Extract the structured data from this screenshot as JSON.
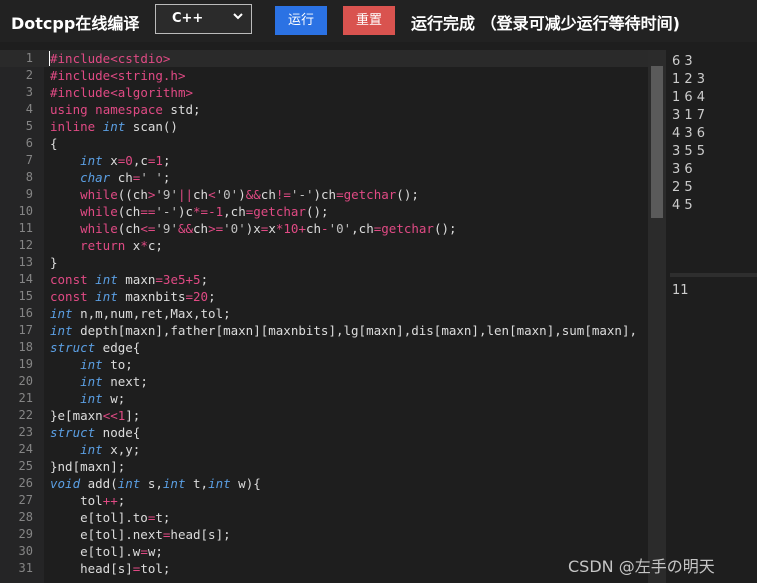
{
  "app": {
    "title": "Dotcpp在线编译"
  },
  "toolbar": {
    "language": "C++",
    "run_label": "运行",
    "reset_label": "重置",
    "status": "运行完成 （登录可减少运行等待时间)"
  },
  "editor": {
    "lines": [
      {
        "n": "1",
        "h": "<span class=\"kw\">#include</span><span class=\"kw\">&lt;cstdio&gt;</span>"
      },
      {
        "n": "2",
        "h": "<span class=\"kw\">#include</span><span class=\"kw\">&lt;string.h&gt;</span>"
      },
      {
        "n": "3",
        "h": "<span class=\"kw\">#include</span><span class=\"kw\">&lt;algorithm&gt;</span>"
      },
      {
        "n": "4",
        "h": "<span class=\"kw\">using</span> <span class=\"kw\">namespace</span> std;"
      },
      {
        "n": "5",
        "h": "<span class=\"kw\">inline</span> <span class=\"ty\">int</span> scan()"
      },
      {
        "n": "6",
        "h": "{"
      },
      {
        "n": "7",
        "h": "    <span class=\"ty\">int</span> x<span class=\"kw\">=</span><span class=\"kw\">0</span>,c<span class=\"kw\">=</span><span class=\"kw\">1</span>;"
      },
      {
        "n": "8",
        "h": "    <span class=\"ty\">char</span> ch<span class=\"kw\">=</span><span class=\"st\">' '</span>;"
      },
      {
        "n": "9",
        "h": "    <span class=\"kw\">while</span>((ch<span class=\"kw\">&gt;</span><span class=\"st\">'9'</span><span class=\"kw\">||</span>ch<span class=\"kw\">&lt;</span><span class=\"st\">'0'</span>)<span class=\"kw\">&amp;&amp;</span>ch<span class=\"kw\">!=</span><span class=\"st\">'-'</span>)ch<span class=\"kw\">=</span><span class=\"kw\">getchar</span>();"
      },
      {
        "n": "10",
        "h": "    <span class=\"kw\">while</span>(ch<span class=\"kw\">==</span><span class=\"st\">'-'</span>)c<span class=\"kw\">*=-</span><span class=\"kw\">1</span>,ch<span class=\"kw\">=</span><span class=\"kw\">getchar</span>();"
      },
      {
        "n": "11",
        "h": "    <span class=\"kw\">while</span>(ch<span class=\"kw\">&lt;=</span><span class=\"st\">'9'</span><span class=\"kw\">&amp;&amp;</span>ch<span class=\"kw\">&gt;=</span><span class=\"st\">'0'</span>)x<span class=\"kw\">=</span>x<span class=\"kw\">*</span><span class=\"kw\">10</span><span class=\"kw\">+</span>ch<span class=\"kw\">-</span><span class=\"st\">'0'</span>,ch<span class=\"kw\">=</span><span class=\"kw\">getchar</span>();"
      },
      {
        "n": "12",
        "h": "    <span class=\"kw\">return</span> x<span class=\"kw\">*</span>c;"
      },
      {
        "n": "13",
        "h": "}"
      },
      {
        "n": "14",
        "h": "<span class=\"kw\">const</span> <span class=\"ty\">int</span> maxn<span class=\"kw\">=</span><span class=\"kw\">3e5</span><span class=\"kw\">+</span><span class=\"kw\">5</span>;"
      },
      {
        "n": "15",
        "h": "<span class=\"kw\">const</span> <span class=\"ty\">int</span> maxnbits<span class=\"kw\">=</span><span class=\"kw\">20</span>;"
      },
      {
        "n": "16",
        "h": "<span class=\"ty\">int</span> n,m,num,ret,Max,tol;"
      },
      {
        "n": "17",
        "h": "<span class=\"ty\">int</span> depth[maxn],father[maxn][maxnbits],lg[maxn],dis[maxn],len[maxn],sum[maxn],"
      },
      {
        "n": "18",
        "h": "<span class=\"ty\">struct</span> edge{"
      },
      {
        "n": "19",
        "h": "    <span class=\"ty\">int</span> to;"
      },
      {
        "n": "20",
        "h": "    <span class=\"ty\">int</span> next;"
      },
      {
        "n": "21",
        "h": "    <span class=\"ty\">int</span> w;"
      },
      {
        "n": "22",
        "h": "}e[maxn<span class=\"kw\">&lt;&lt;</span><span class=\"kw\">1</span>];"
      },
      {
        "n": "23",
        "h": "<span class=\"ty\">struct</span> node{"
      },
      {
        "n": "24",
        "h": "    <span class=\"ty\">int</span> x,y;"
      },
      {
        "n": "25",
        "h": "}nd[maxn];"
      },
      {
        "n": "26",
        "h": "<span class=\"ty\">void</span> add(<span class=\"ty\">int</span> s,<span class=\"ty\">int</span> t,<span class=\"ty\">int</span> w){"
      },
      {
        "n": "27",
        "h": "    tol<span class=\"kw\">++</span>;"
      },
      {
        "n": "28",
        "h": "    e[tol].to<span class=\"kw\">=</span>t;"
      },
      {
        "n": "29",
        "h": "    e[tol].next<span class=\"kw\">=</span>head[s];"
      },
      {
        "n": "30",
        "h": "    e[tol].w<span class=\"kw\">=</span>w;"
      },
      {
        "n": "31",
        "h": "    head[s]<span class=\"kw\">=</span>tol;"
      }
    ]
  },
  "input": [
    "6 3",
    "1 2 3",
    "1 6 4",
    "3 1 7",
    "4 3 6",
    "3 5 5",
    "3 6",
    "2 5",
    "4 5"
  ],
  "output": "11",
  "watermark": "CSDN @左手の明天"
}
